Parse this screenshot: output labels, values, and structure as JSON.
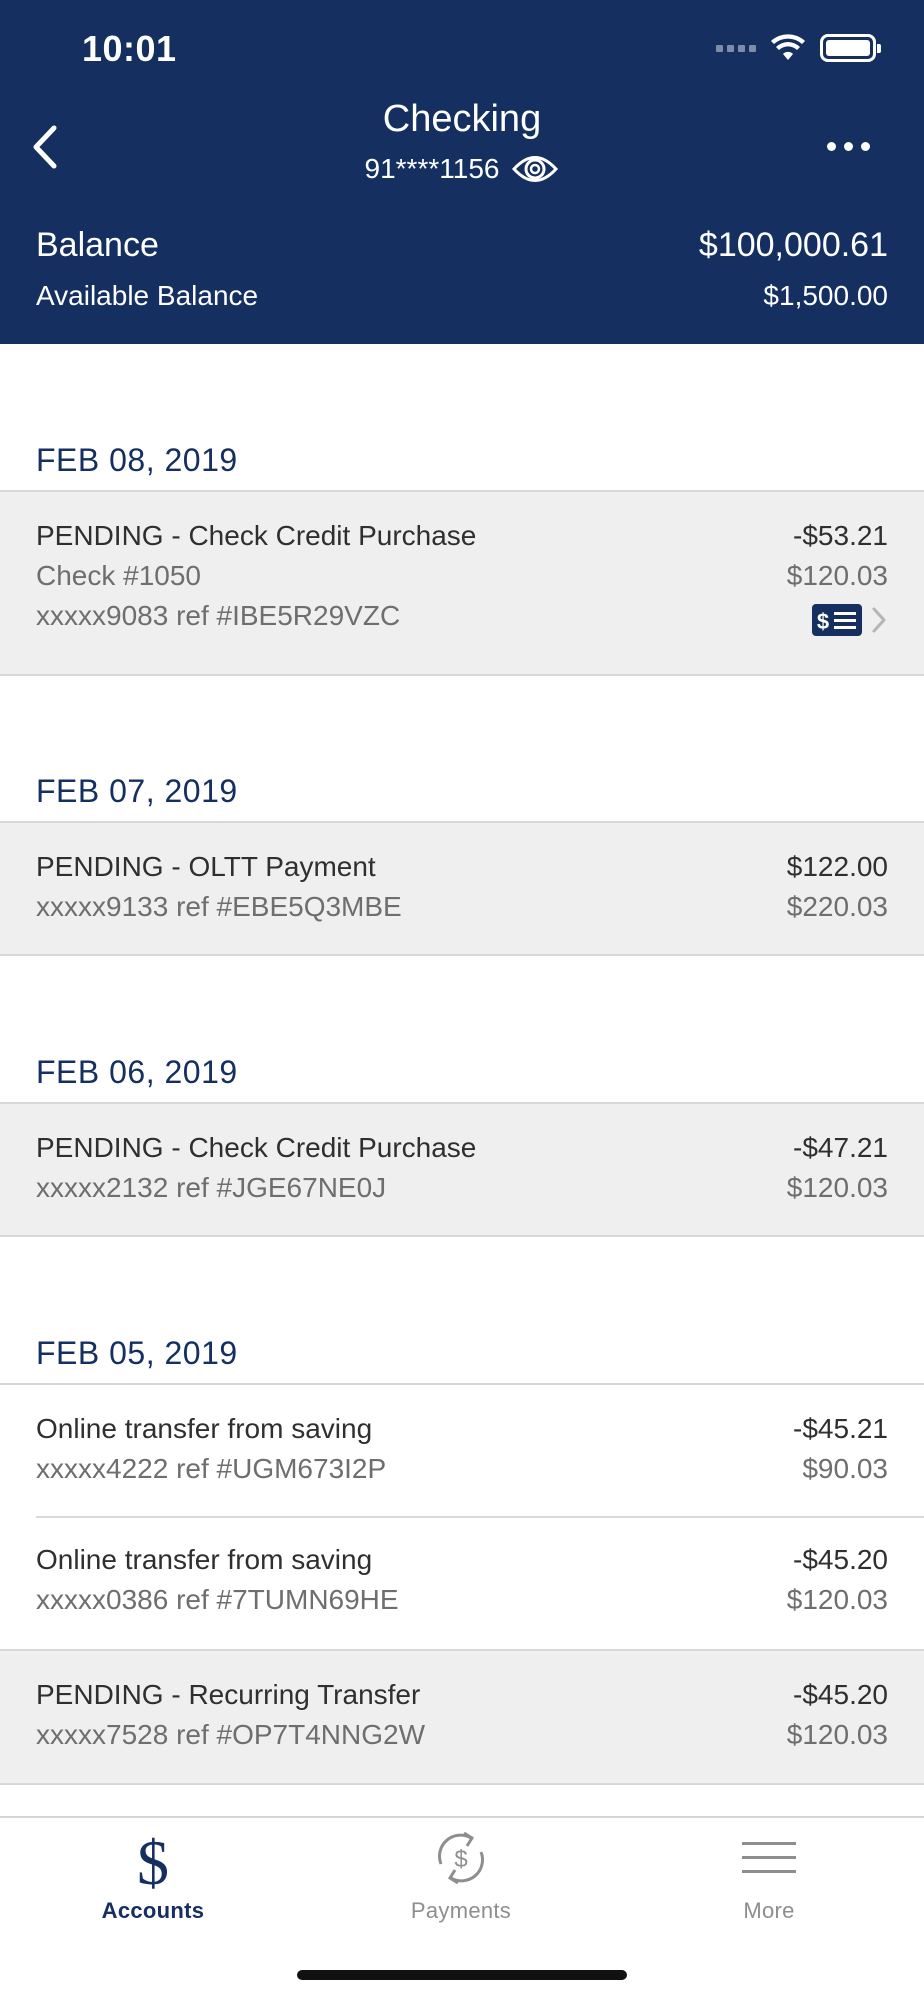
{
  "status_bar": {
    "time": "10:01"
  },
  "header": {
    "title": "Checking",
    "account_number": "91****1156",
    "balance_label": "Balance",
    "balance_value": "$100,000.61",
    "available_label": "Available Balance",
    "available_value": "$1,500.00"
  },
  "groups": [
    {
      "date": "FEB 08, 2019",
      "transactions": [
        {
          "title": "PENDING - Check Credit Purchase",
          "line2": "Check #1050",
          "line3": "xxxxx9083 ref #IBE5R29VZC",
          "amount": "-$53.21",
          "balance": "$120.03",
          "pending": true,
          "has_check_image": true
        }
      ]
    },
    {
      "date": "FEB 07, 2019",
      "transactions": [
        {
          "title": "PENDING - OLTT Payment",
          "line2": "xxxxx9133 ref #EBE5Q3MBE",
          "amount": "$122.00",
          "balance": "$220.03",
          "pending": true
        }
      ]
    },
    {
      "date": "FEB 06, 2019",
      "transactions": [
        {
          "title": "PENDING - Check Credit Purchase",
          "line2": "xxxxx2132 ref #JGE67NE0J",
          "amount": "-$47.21",
          "balance": "$120.03",
          "pending": true
        }
      ]
    },
    {
      "date": "FEB 05, 2019",
      "transactions": [
        {
          "title": "Online transfer from saving",
          "line2": "xxxxx4222 ref #UGM673I2P",
          "amount": "-$45.21",
          "balance": "$90.03",
          "pending": false
        },
        {
          "title": "Online transfer from saving",
          "line2": "xxxxx0386 ref #7TUMN69HE",
          "amount": "-$45.20",
          "balance": "$120.03",
          "pending": false
        },
        {
          "title": "PENDING - Recurring Transfer",
          "line2": "xxxxx7528 ref #OP7T4NNG2W",
          "amount": "-$45.20",
          "balance": "$120.03",
          "pending": true
        }
      ]
    }
  ],
  "tabbar": {
    "accounts": "Accounts",
    "payments": "Payments",
    "more": "More"
  },
  "icons": {
    "back": "chevron-left-icon",
    "eye": "eye-icon",
    "more": "ellipsis-icon",
    "check": "check-image-icon",
    "accounts": "dollar-icon",
    "payments": "dollar-cycle-icon",
    "more_tab": "menu-lines-icon"
  },
  "colors": {
    "header_bg": "#142f60",
    "pending_bg": "#efefef",
    "active_tab": "#142f60"
  }
}
